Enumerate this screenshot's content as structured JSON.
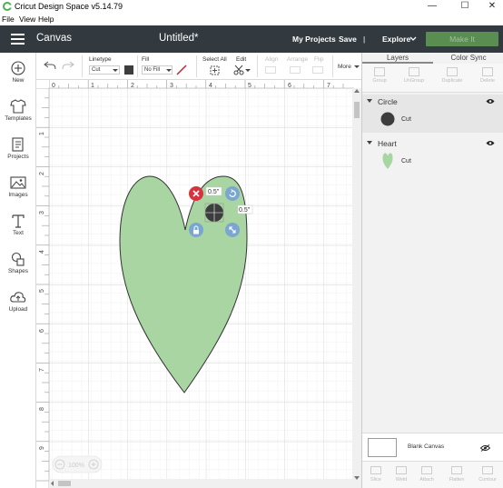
{
  "titlebar": {
    "title": "Cricut Design Space  v5.14.79",
    "minimize": "—",
    "maximize": "☐",
    "close": "✕"
  },
  "menu": {
    "file": "File",
    "view": "View",
    "help": "Help"
  },
  "header": {
    "section": "Canvas",
    "document_title": "Untitled*",
    "my_projects": "My Projects",
    "save": "Save",
    "divider": "|",
    "explore": "Explore",
    "make_it": "Make It"
  },
  "toolbar": {
    "linetype_label": "Linetype",
    "linetype_value": "Cut",
    "fill_label": "Fill",
    "fill_value": "No Fill",
    "select_all": "Select All",
    "edit": "Edit",
    "align": "Align",
    "arrange": "Arrange",
    "flip": "Flip",
    "more": "More"
  },
  "sidebar": {
    "items": [
      {
        "label": "New",
        "icon": "plus-circle-icon"
      },
      {
        "label": "Templates",
        "icon": "tshirt-icon"
      },
      {
        "label": "Projects",
        "icon": "projects-icon"
      },
      {
        "label": "Images",
        "icon": "image-icon"
      },
      {
        "label": "Text",
        "icon": "text-icon"
      },
      {
        "label": "Shapes",
        "icon": "shapes-icon"
      },
      {
        "label": "Upload",
        "icon": "upload-icon"
      }
    ]
  },
  "canvas": {
    "ruler_top": [
      "0",
      "1",
      "2",
      "3",
      "4",
      "5",
      "6",
      "7"
    ],
    "ruler_left": [
      "1",
      "2",
      "3",
      "4",
      "5",
      "6",
      "7",
      "8",
      "9"
    ],
    "size_width": "0.5\"",
    "size_height": "0.5\"",
    "zoom": "100%",
    "heart_color": "#a8d5a2",
    "circle_color": "#3d3d3d",
    "delete_color": "#d9323f",
    "handle_color": "#7aa6cf"
  },
  "panel": {
    "tab_layers": "Layers",
    "tab_color_sync": "Color Sync",
    "tools": [
      "Group",
      "UnGroup",
      "Duplicate",
      "Delete"
    ],
    "layers": [
      {
        "name": "Circle",
        "operation": "Cut",
        "color": "#3d3d3d"
      },
      {
        "name": "Heart",
        "operation": "Cut",
        "color": "#a8d5a2"
      }
    ],
    "blank_canvas": "Blank Canvas",
    "bottom_tools": [
      "Slice",
      "Weld",
      "Attach",
      "Flatten",
      "Contour"
    ]
  }
}
